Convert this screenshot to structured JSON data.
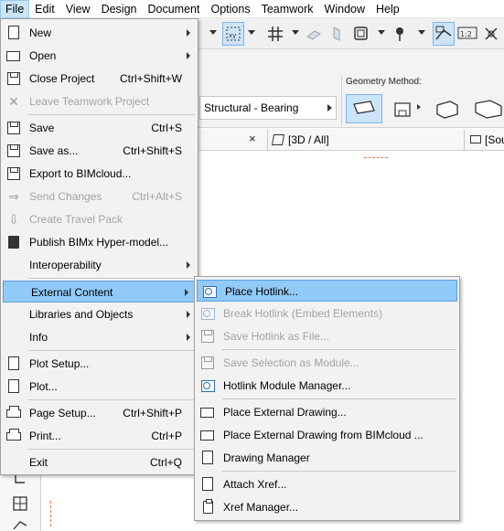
{
  "menubar": {
    "items": [
      "File",
      "Edit",
      "View",
      "Design",
      "Document",
      "Options",
      "Teamwork",
      "Window",
      "Help"
    ]
  },
  "infobox": {
    "structural_value": "Structural - Bearing",
    "geometry_label": "Geometry Method:"
  },
  "tabs": {
    "close_glyph": "×",
    "view_3d": "[3D / All]",
    "view_section": "[Sou"
  },
  "file_menu": {
    "items": [
      {
        "label": "New",
        "shortcut": "",
        "submenu": true,
        "disabled": false,
        "icon": "new-document-icon"
      },
      {
        "label": "Open",
        "shortcut": "",
        "submenu": true,
        "disabled": false,
        "icon": "open-folder-icon"
      },
      {
        "label": "Close Project",
        "shortcut": "Ctrl+Shift+W",
        "submenu": false,
        "disabled": false,
        "icon": "close-project-icon"
      },
      {
        "label": "Leave Teamwork Project",
        "shortcut": "",
        "submenu": false,
        "disabled": true,
        "icon": "leave-teamwork-icon"
      },
      {
        "label": "Save",
        "shortcut": "Ctrl+S",
        "submenu": false,
        "disabled": false,
        "icon": "save-icon"
      },
      {
        "label": "Save as...",
        "shortcut": "Ctrl+Shift+S",
        "submenu": false,
        "disabled": false,
        "icon": "save-as-icon"
      },
      {
        "label": "Export to BIMcloud...",
        "shortcut": "",
        "submenu": false,
        "disabled": false,
        "icon": "export-bimcloud-icon"
      },
      {
        "label": "Send Changes",
        "shortcut": "Ctrl+Alt+S",
        "submenu": false,
        "disabled": true,
        "icon": "send-changes-icon"
      },
      {
        "label": "Create Travel Pack",
        "shortcut": "",
        "submenu": false,
        "disabled": true,
        "icon": "travel-pack-icon"
      },
      {
        "label": "Publish BIMx Hyper-model...",
        "shortcut": "",
        "submenu": false,
        "disabled": false,
        "icon": "bimx-icon"
      },
      {
        "label": "Interoperability",
        "shortcut": "",
        "submenu": true,
        "disabled": false,
        "icon": ""
      },
      {
        "label": "External Content",
        "shortcut": "",
        "submenu": true,
        "disabled": false,
        "icon": ""
      },
      {
        "label": "Libraries and Objects",
        "shortcut": "",
        "submenu": true,
        "disabled": false,
        "icon": ""
      },
      {
        "label": "Info",
        "shortcut": "",
        "submenu": true,
        "disabled": false,
        "icon": ""
      },
      {
        "label": "Plot Setup...",
        "shortcut": "",
        "submenu": false,
        "disabled": false,
        "icon": "plot-setup-icon"
      },
      {
        "label": "Plot...",
        "shortcut": "",
        "submenu": false,
        "disabled": false,
        "icon": "plot-icon"
      },
      {
        "label": "Page Setup...",
        "shortcut": "Ctrl+Shift+P",
        "submenu": false,
        "disabled": false,
        "icon": "page-setup-icon"
      },
      {
        "label": "Print...",
        "shortcut": "Ctrl+P",
        "submenu": false,
        "disabled": false,
        "icon": "print-icon"
      },
      {
        "label": "Exit",
        "shortcut": "Ctrl+Q",
        "submenu": false,
        "disabled": false,
        "icon": ""
      }
    ]
  },
  "external_content_menu": {
    "items": [
      {
        "label": "Place Hotlink...",
        "disabled": false,
        "icon": "place-hotlink-icon"
      },
      {
        "label": "Break Hotlink (Embed Elements)",
        "disabled": true,
        "icon": "break-hotlink-icon"
      },
      {
        "label": "Save Hotlink as File...",
        "disabled": true,
        "icon": "save-hotlink-icon"
      },
      {
        "label": "Save Selection as Module...",
        "disabled": true,
        "icon": "save-module-icon"
      },
      {
        "label": "Hotlink Module Manager...",
        "disabled": false,
        "icon": "hotlink-manager-icon"
      },
      {
        "label": "Place External Drawing...",
        "disabled": false,
        "icon": "external-drawing-icon"
      },
      {
        "label": "Place External Drawing from BIMcloud ...",
        "disabled": false,
        "icon": "external-drawing-bimcloud-icon"
      },
      {
        "label": "Drawing Manager",
        "disabled": false,
        "icon": "drawing-manager-icon"
      },
      {
        "label": "Attach Xref...",
        "disabled": false,
        "icon": "attach-xref-icon"
      },
      {
        "label": "Xref Manager...",
        "disabled": false,
        "icon": "xref-manager-icon"
      }
    ]
  }
}
